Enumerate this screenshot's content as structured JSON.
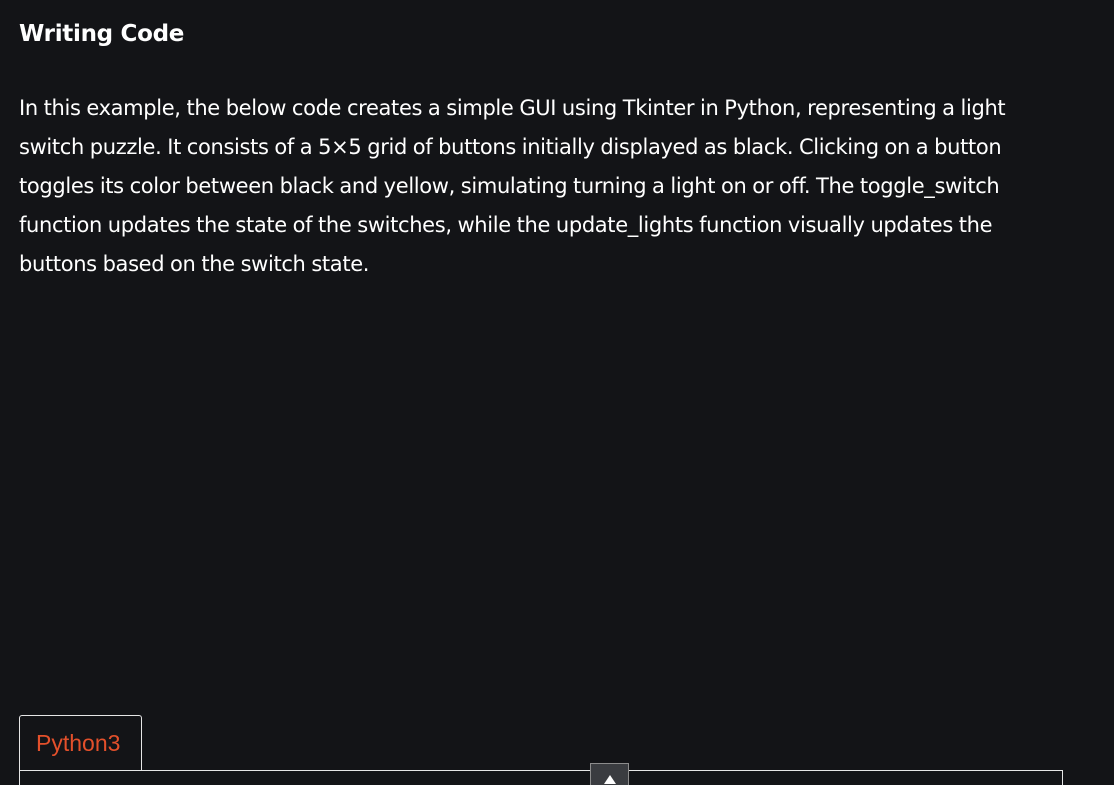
{
  "section": {
    "heading": "Writing Code",
    "paragraph": "In this example, the below code creates a simple GUI using Tkinter in Python, representing a light switch puzzle. It consists of a 5×5 grid of buttons initially displayed as black. Clicking on a button toggles its color between black and yellow, simulating turning a light on or off. The toggle_switch function updates the state of the switches, while the update_lights function visually updates the buttons based on the switch state."
  },
  "code_block": {
    "tabs": [
      {
        "label": "Python3",
        "active": true
      }
    ],
    "scroll_button_icon": "arrow-up-icon"
  },
  "colors": {
    "background": "#131417",
    "text": "#ffffff",
    "tab_accent": "#e3502b",
    "border": "#e6e6e6"
  }
}
